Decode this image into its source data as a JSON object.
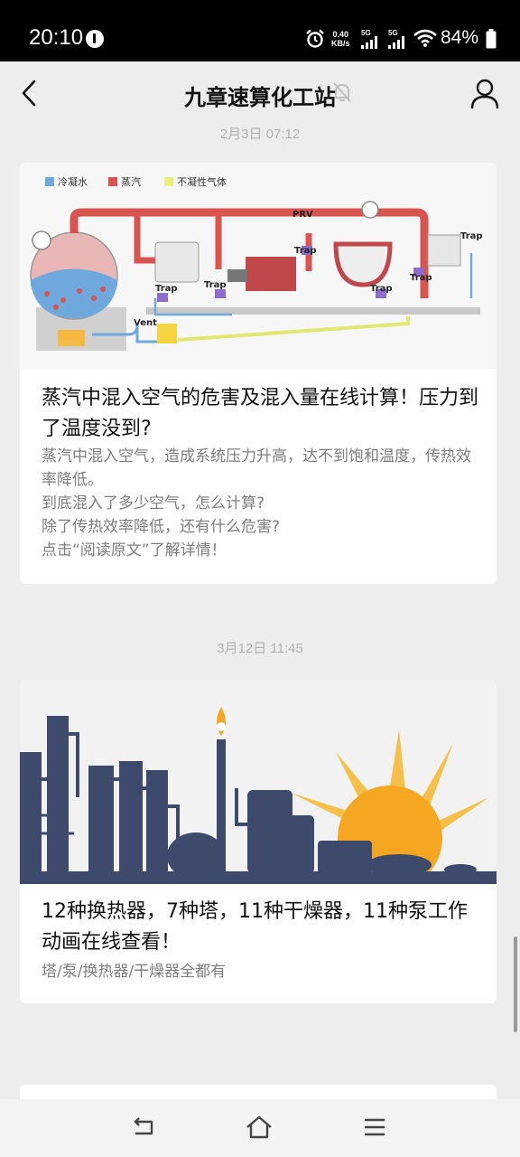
{
  "status_bar": {
    "time": "20:10",
    "net_speed_value": "0.40",
    "net_speed_unit": "KB/s",
    "sim1_label": "5G",
    "sim2_label": "5G",
    "battery": "84%"
  },
  "header": {
    "title": "九章速算化工站",
    "back_icon": "chevron-left-icon",
    "mute_icon": "bell-off-icon",
    "profile_icon": "person-icon"
  },
  "messages": [
    {
      "timestamp": "2月3日 07:12",
      "image_labels": {
        "legend_condensate": "冷凝水",
        "legend_steam": "蒸汽",
        "legend_noncondensable": "不凝性气体",
        "prv": "PRV",
        "trap": "Trap",
        "vent": "Vent"
      },
      "title": "蒸汽中混入空气的危害及混入量在线计算！压力到了温度没到?",
      "desc_lines": [
        "蒸汽中混入空气，造成系统压力升高，达不到饱和温度，传热效率降低。",
        "到底混入了多少空气，怎么计算?",
        "除了传热效率降低，还有什么危害?",
        "点击“阅读原文”了解详情！"
      ]
    },
    {
      "timestamp": "3月12日 11:45",
      "title": "12种换热器，7种塔，11种干燥器，11种泵工作动画在线查看！",
      "desc_lines": [
        "塔/泵/换热器/干燥器全都有"
      ]
    }
  ],
  "nav_bar": {
    "back_icon": "nav-back-icon",
    "home_icon": "nav-home-icon",
    "menu_icon": "nav-menu-icon"
  },
  "colors": {
    "background": "#ededed",
    "card": "#ffffff",
    "text_primary": "#111111",
    "text_secondary": "#7d7d7d",
    "timestamp": "#b1b1b1",
    "steam_red": "#d9534f",
    "condensate_blue": "#6fa8dc",
    "industrial_navy": "#3d4a6b",
    "sun_orange": "#f5a623"
  }
}
